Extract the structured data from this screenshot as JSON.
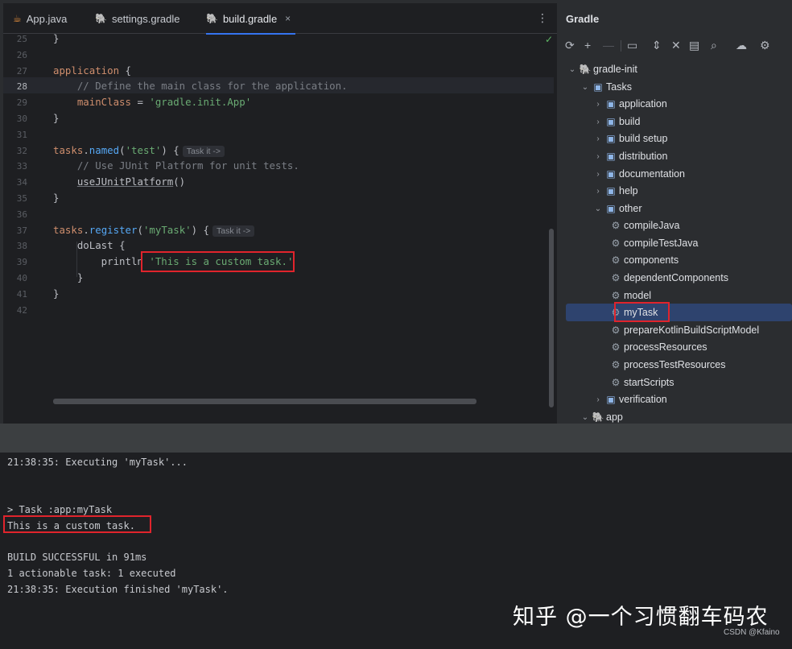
{
  "editor": {
    "tabs": [
      {
        "label": "App.java",
        "icon": "java-file-icon"
      },
      {
        "label": "settings.gradle",
        "icon": "gradle-file-icon"
      },
      {
        "label": "build.gradle",
        "icon": "gradle-file-icon",
        "active": true,
        "close": "×"
      }
    ],
    "menu_glyph": "⋮",
    "check_glyph": "✓",
    "line_numbers": [
      "25",
      "26",
      "27",
      "28",
      "29",
      "30",
      "31",
      "32",
      "33",
      "34",
      "35",
      "36",
      "37",
      "38",
      "39",
      "40",
      "41",
      "42"
    ],
    "current_line": "28",
    "code": {
      "l25": "}",
      "l27a": "application",
      "l27b": " {",
      "l28": "    // Define the main class for the application.",
      "l29a": "    mainClass",
      "l29b": " = ",
      "l29c": "'gradle.init.App'",
      "l30": "}",
      "l32a": "tasks",
      "l32b": ".",
      "l32c": "named",
      "l32d": "(",
      "l32e": "'test'",
      "l32f": ") {",
      "l32hint": "Task it ->",
      "l33": "    // Use JUnit Platform for unit tests.",
      "l34a": "    ",
      "l34b": "useJUnitPlatform",
      "l34c": "()",
      "l35": "}",
      "l37a": "tasks",
      "l37b": ".",
      "l37c": "register",
      "l37d": "(",
      "l37e": "'myTask'",
      "l37f": ") {",
      "l37hint": "Task it ->",
      "l38a": "    doLast",
      "l38b": " {",
      "l39a": "        println",
      "l39b": " ",
      "l39c": "'This is a custom task.'",
      "l40": "    }",
      "l41": "}"
    }
  },
  "gradle": {
    "title": "Gradle",
    "toolbar": [
      "⟳",
      "+",
      "—",
      "▭",
      "⇕",
      "✕",
      "▤",
      "⌕",
      "☁",
      "⚙"
    ],
    "tree": {
      "root": "gradle-init",
      "tasks": "Tasks",
      "groups": [
        "application",
        "build",
        "build setup",
        "distribution",
        "documentation",
        "help"
      ],
      "other": "other",
      "other_tasks": [
        "compileJava",
        "compileTestJava",
        "components",
        "dependentComponents",
        "model",
        "myTask",
        "prepareKotlinBuildScriptModel",
        "processResources",
        "processTestResources",
        "startScripts"
      ],
      "verification": "verification",
      "app": "app"
    },
    "selected": "myTask"
  },
  "console": {
    "lines": [
      "21:38:35: Executing 'myTask'...",
      "> Task :app:myTask",
      "This is a custom task.",
      "BUILD SUCCESSFUL in 91ms",
      "1 actionable task: 1 executed",
      "21:38:35: Execution finished 'myTask'."
    ]
  },
  "watermark": "知乎 @一个习惯翻车码农",
  "credit": "CSDN @Kfaino",
  "colors": {
    "highlight_box": "#e0242c",
    "selection": "#2e436e",
    "keyword": "#cf8e6d",
    "string": "#6aab73",
    "comment": "#7a7e85",
    "method": "#56a8f5"
  }
}
